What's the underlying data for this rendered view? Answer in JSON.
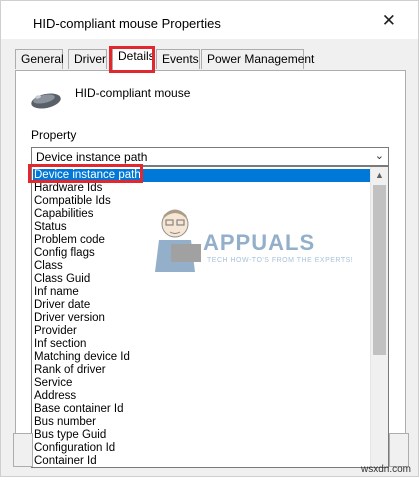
{
  "window": {
    "title": "HID-compliant mouse Properties",
    "close_glyph": "✕"
  },
  "tabs": [
    {
      "label": "General"
    },
    {
      "label": "Driver"
    },
    {
      "label": "Details"
    },
    {
      "label": "Events"
    },
    {
      "label": "Power Management"
    }
  ],
  "active_tab": "Details",
  "device": {
    "name": "HID-compliant mouse",
    "icon": "mouse-icon"
  },
  "property": {
    "label": "Property",
    "selected": "Device instance path",
    "options": [
      "Device instance path",
      "Hardware Ids",
      "Compatible Ids",
      "Capabilities",
      "Status",
      "Problem code",
      "Config flags",
      "Class",
      "Class Guid",
      "Inf name",
      "Driver date",
      "Driver version",
      "Provider",
      "Inf section",
      "Matching device Id",
      "Rank of driver",
      "Service",
      "Address",
      "Base container Id",
      "Bus number",
      "Bus type Guid",
      "Configuration Id",
      "Container Id"
    ]
  },
  "watermark": {
    "brand": "APPUALS",
    "tagline": "TECH HOW-TO'S FROM THE EXPERTS!"
  },
  "site": "wsxdn.com",
  "colors": {
    "highlight": "#e0282e",
    "selection": "#0078d7",
    "window_bg": "#f0f0f0"
  }
}
